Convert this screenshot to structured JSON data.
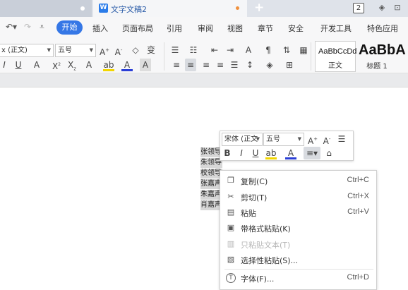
{
  "tabs": {
    "doc_title": "文字文稿2",
    "window_count": "2",
    "doc_icon_letter": "W"
  },
  "menu": {
    "items": [
      "开始",
      "插入",
      "页面布局",
      "引用",
      "审阅",
      "视图",
      "章节",
      "安全",
      "开发工具",
      "特色应用"
    ]
  },
  "ribbon": {
    "font_name": "x (正文)",
    "font_size": "五号",
    "style_normal_sample": "AaBbCcDd",
    "style_normal_name": "正文",
    "style_h1_sample": "AaBbA",
    "style_h1_name": "标题 1"
  },
  "document": {
    "lines": [
      "张领导",
      "朱领导",
      "校领导",
      "张嘉声",
      "朱嘉声",
      "肖嘉声"
    ]
  },
  "mini_toolbar": {
    "font_name": "宋体 (正文",
    "font_size": "五号"
  },
  "context_menu": {
    "items": [
      {
        "icon": "copy-icon",
        "label": "复制(C)",
        "shortcut": "Ctrl+C",
        "enabled": true
      },
      {
        "icon": "cut-icon",
        "label": "剪切(T)",
        "shortcut": "Ctrl+X",
        "enabled": true
      },
      {
        "icon": "paste-icon",
        "label": "粘贴",
        "shortcut": "Ctrl+V",
        "enabled": true
      },
      {
        "icon": "paste-format-icon",
        "label": "带格式粘贴(K)",
        "shortcut": "",
        "enabled": true
      },
      {
        "icon": "paste-text-icon",
        "label": "只粘贴文本(T)",
        "shortcut": "",
        "enabled": false
      },
      {
        "icon": "paste-special-icon",
        "label": "选择性粘贴(S)...",
        "shortcut": "",
        "enabled": true
      },
      {
        "icon": "font-icon",
        "label": "字体(F)...",
        "shortcut": "Ctrl+D",
        "enabled": true
      }
    ]
  },
  "colors": {
    "accent": "#3577e6",
    "font_color_bar": "#2b3fd6",
    "highlight_bar": "#f2d600"
  }
}
